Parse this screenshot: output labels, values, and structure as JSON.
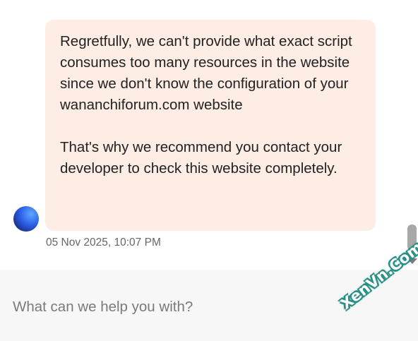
{
  "message": {
    "paragraphs": [
      "Regretfully, we can't provide what exact script consumes too many resources in the website since we don't know the configuration of your wananchiforum.com website",
      "That's why we recommend you contact your developer to check this website completely."
    ],
    "timestamp": "05 Nov 2025, 10:07 PM"
  },
  "composer": {
    "placeholder": "What can we help you with?"
  },
  "watermark": {
    "text": "XenVn.Com"
  },
  "colors": {
    "bubble_background": "#fdede4",
    "composer_background": "#f7f7f7",
    "avatar_accent": "#2a5fe6",
    "watermark_accent": "#2a8f86"
  },
  "icons": {
    "avatar": "agent-avatar-icon",
    "scroll_down": "chevron-down-icon"
  }
}
